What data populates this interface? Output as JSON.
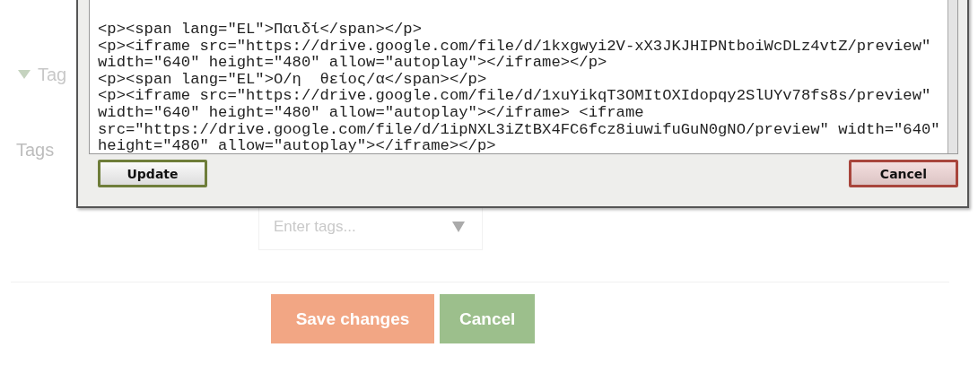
{
  "page": {
    "section_heading": {
      "label": "Tag",
      "expanded": true
    },
    "tags_label": "Tags",
    "tags_field": {
      "placeholder": "Enter tags..."
    },
    "buttons": [
      {
        "label": "Save changes",
        "kind": "primary"
      },
      {
        "label": "Cancel",
        "kind": "secondary"
      }
    ]
  },
  "dialog": {
    "code_lines": [
      "<p><span lang=\"EL\">Παιδί</span></p>",
      "<p><iframe src=\"https://drive.google.com/file/d/1kxgwyi2V-xX3JKJHIPNtboiWcDLz4vtZ/preview\"",
      "width=\"640\" height=\"480\" allow=\"autoplay\"></iframe></p>",
      "<p><span lang=\"EL\">Ο/η  θείος/α</span></p>",
      "<p><iframe src=\"https://drive.google.com/file/d/1xuYikqT3OMItOXIdopqy2SlUYv78fs8s/preview\"",
      "width=\"640\" height=\"480\" allow=\"autoplay\"></iframe> <iframe",
      "src=\"https://drive.google.com/file/d/1ipNXL3iZtBX4FC6fcz8iuwifuGuN0gNO/preview\" width=\"640\"",
      "height=\"480\" allow=\"autoplay\"></iframe></p>"
    ],
    "buttons": [
      {
        "label": "Update",
        "kind": "confirm"
      },
      {
        "label": "Cancel",
        "kind": "cancel"
      }
    ]
  }
}
